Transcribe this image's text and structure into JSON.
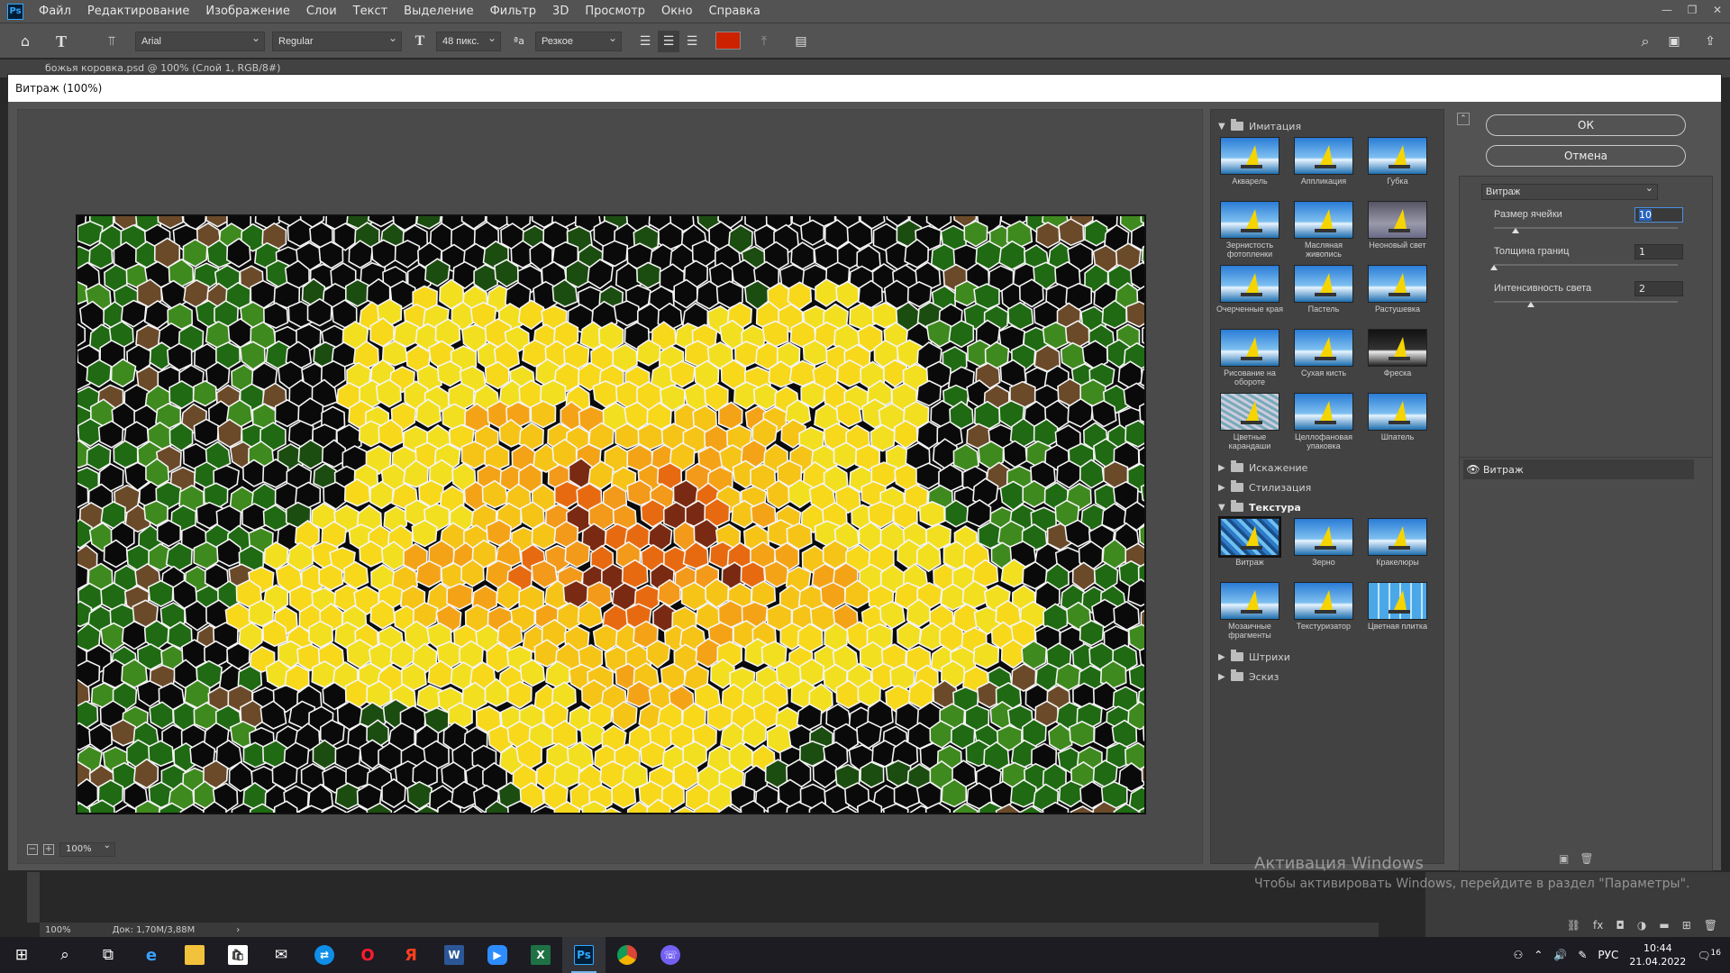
{
  "app": {
    "logo": "Ps"
  },
  "menu": [
    "Файл",
    "Редактирование",
    "Изображение",
    "Слои",
    "Текст",
    "Выделение",
    "Фильтр",
    "3D",
    "Просмотр",
    "Окно",
    "Справка"
  ],
  "options": {
    "font_family": "Arial",
    "font_style": "Regular",
    "font_size": "48 пикс.",
    "antialias": "Резкое",
    "text_color": "#cc2200"
  },
  "document_tab": "божья коровка.psd @ 100% (Слой 1, RGB/8#)",
  "dialog": {
    "title": "Витраж (100%)",
    "zoom": "100%",
    "ok_label": "ОК",
    "cancel_label": "Отмена"
  },
  "gallery": {
    "categories": [
      {
        "name": "Имитация",
        "open": true,
        "filters": [
          "Акварель",
          "Аппликация",
          "Губка",
          "Зернистость фотопленки",
          "Масляная живопись",
          "Неоновый свет",
          "Очерченные края",
          "Пастель",
          "Растушевка",
          "Рисование на обороте",
          "Сухая кисть",
          "Фреска",
          "Цветные карандаши",
          "Целлофановая упаковка",
          "Шпатель"
        ]
      },
      {
        "name": "Искажение",
        "open": false
      },
      {
        "name": "Стилизация",
        "open": false
      },
      {
        "name": "Текстура",
        "open": true,
        "filters": [
          "Витраж",
          "Зерно",
          "Кракелюры",
          "Мозаичные фрагменты",
          "Текстуризатор",
          "Цветная плитка"
        ]
      },
      {
        "name": "Штрихи",
        "open": false
      },
      {
        "name": "Эскиз",
        "open": false
      }
    ],
    "selected_filter": "Витраж"
  },
  "settings": {
    "filter": "Витраж",
    "params": [
      {
        "label": "Размер ячейки",
        "value": "10",
        "fraction": 0.12
      },
      {
        "label": "Толщина границ",
        "value": "1",
        "fraction": 0.0
      },
      {
        "label": "Интенсивность света",
        "value": "2",
        "fraction": 0.2
      }
    ]
  },
  "layers": {
    "item": "Витраж"
  },
  "status": {
    "zoom": "100%",
    "doc": "Док: 1,70M/3,88M"
  },
  "watermark": {
    "line1": "Активация Windows",
    "line2": "Чтобы активировать Windows, перейдите в раздел \"Параметры\"."
  },
  "tray": {
    "lang": "РУС",
    "time": "10:44",
    "date": "21.04.2022",
    "notif": "16"
  }
}
